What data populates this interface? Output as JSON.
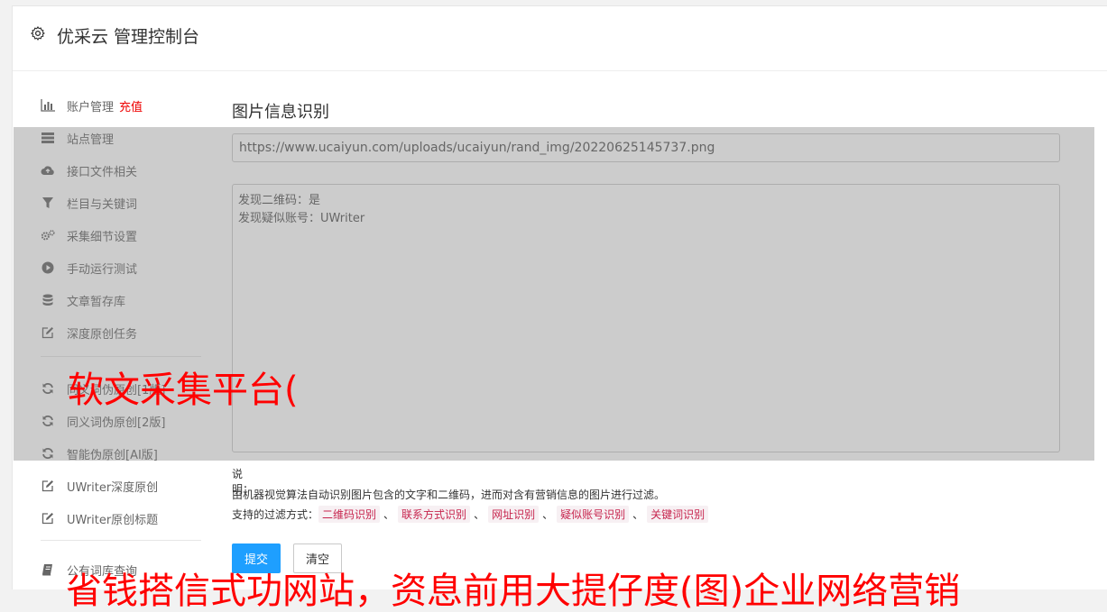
{
  "header": {
    "title": "优采云 管理控制台",
    "icon": "gear-icon"
  },
  "sidebar": {
    "items": [
      {
        "label": "账户管理",
        "extra": "充值",
        "icon": "bar-chart-icon"
      },
      {
        "label": "站点管理",
        "icon": "server-icon"
      },
      {
        "label": "接口文件相关",
        "icon": "cloud-upload-icon"
      },
      {
        "label": "栏目与关键词",
        "icon": "filter-icon"
      },
      {
        "label": "采集细节设置",
        "icon": "gears-icon"
      },
      {
        "label": "手动运行测试",
        "icon": "play-circle-icon"
      },
      {
        "label": "文章暂存库",
        "icon": "database-icon"
      },
      {
        "label": "深度原创任务",
        "icon": "edit-icon"
      },
      {
        "label": "同义词伪原创[1版]",
        "icon": "refresh-icon"
      },
      {
        "label": "同义词伪原创[2版]",
        "icon": "refresh-icon"
      },
      {
        "label": "智能伪原创[AI版]",
        "icon": "refresh-icon"
      },
      {
        "label": "UWriter深度原创",
        "icon": "edit-icon"
      },
      {
        "label": "UWriter原创标题",
        "icon": "edit-icon"
      },
      {
        "label": "公有词库查询",
        "icon": "book-icon"
      }
    ]
  },
  "main": {
    "title": "图片信息识别",
    "url_value": "https://www.ucaiyun.com/uploads/ucaiyun/rand_img/20220625145737.png",
    "result_text": "发现二维码：是\n发现疑似账号：UWriter",
    "desc_label": "说明：",
    "desc_text": "由机器视觉算法自动识别图片包含的文字和二维码，进而对含有营销信息的图片进行过滤。",
    "support_label": "支持的过滤方式：",
    "tags": [
      "二维码识别",
      "联系方式识别",
      "网址识别",
      "疑似账号识别",
      "关键词识别"
    ],
    "tag_separator": "、",
    "submit_label": "提交",
    "clear_label": "清空"
  },
  "watermark": {
    "middle": "软文采集平台(",
    "bottom": "省钱搭信式功网站，资息前用大提仔度(图)企业网络营销"
  }
}
